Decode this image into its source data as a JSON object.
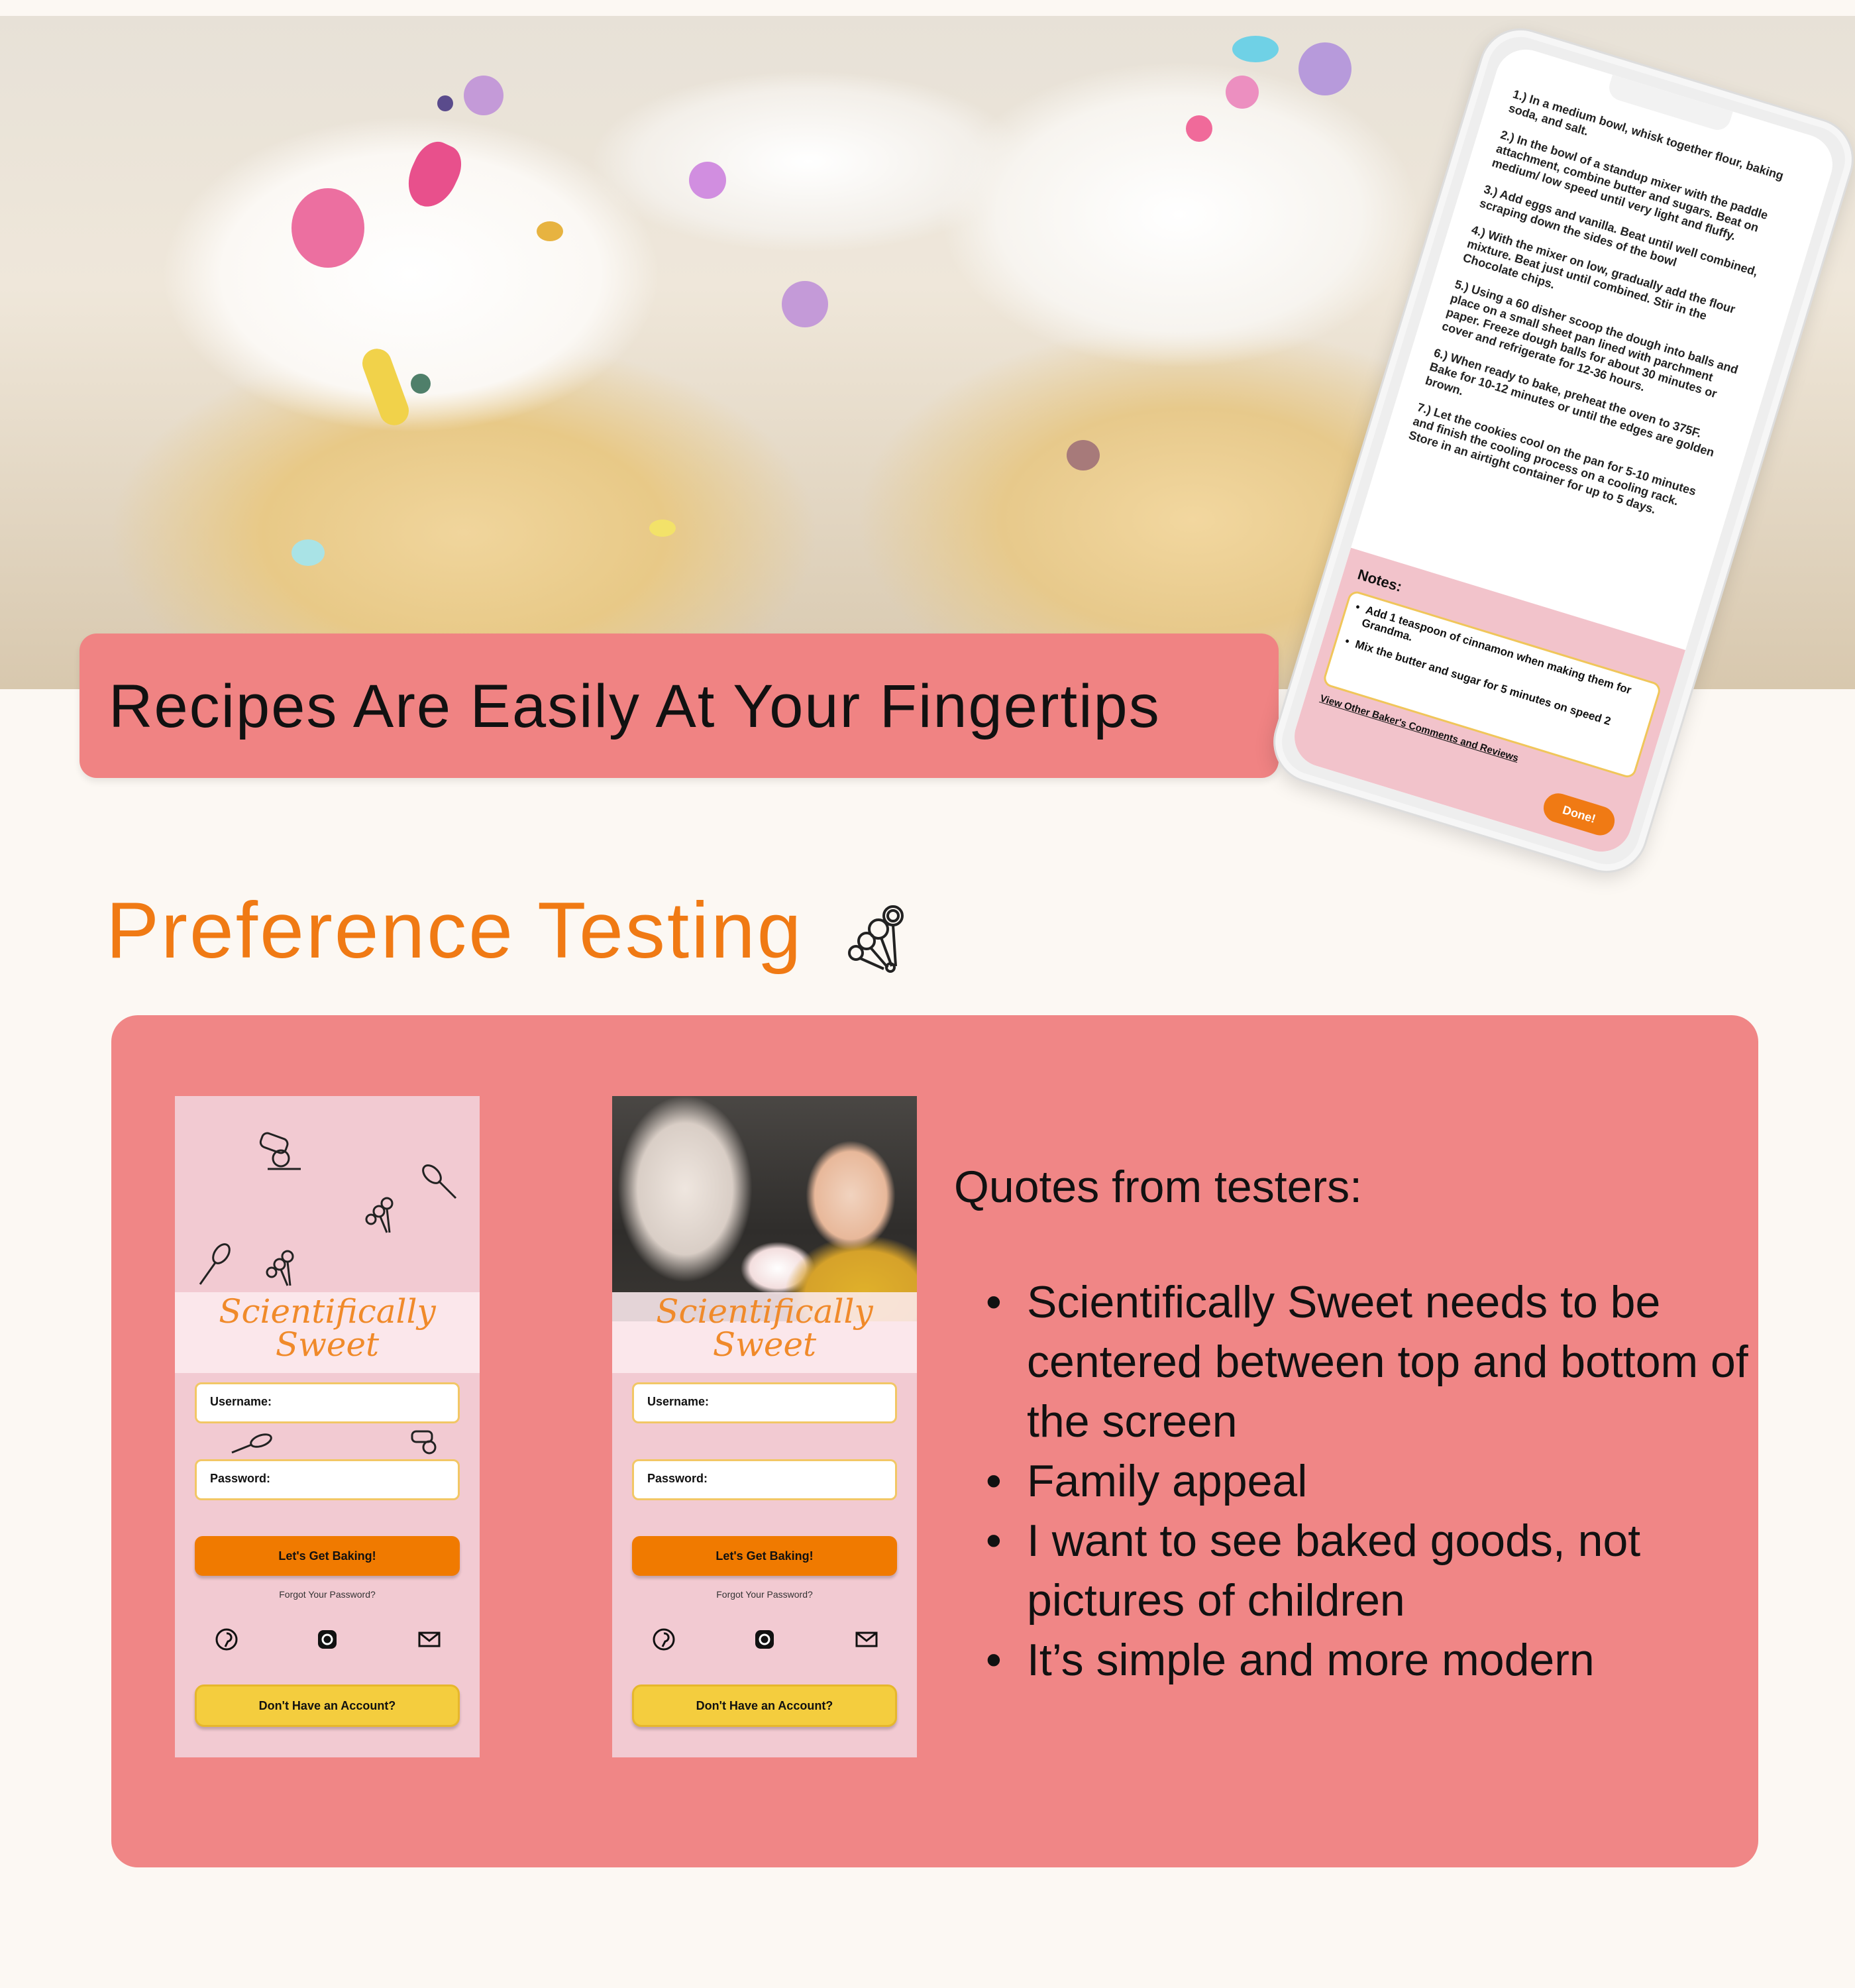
{
  "hero": {
    "banner": "Recipes Are Easily At Your Fingertips"
  },
  "phone": {
    "steps": [
      "1.) In a medium bowl, whisk together flour, baking soda, and salt.",
      "2.) In the bowl of a standup mixer with the paddle attachment, combine butter and sugars. Beat on medium/ low speed until very light and fluffy.",
      "3.) Add eggs and vanilla. Beat until well combined, scraping down the sides of the bowl",
      "4.) With the mixer on low, gradually add the flour mixture. Beat just until combined. Stir in the Chocolate chips.",
      "5.) Using a 60 disher scoop the dough into balls and place on a small sheet pan lined with parchment paper. Freeze dough balls for about 30 minutes or cover and refrigerate for 12-36 hours.",
      "6.) When ready to bake, preheat the oven to 375F. Bake for 10-12 minutes or until the edges are golden brown.",
      "7.) Let the cookies cool on the pan for 5-10 minutes and finish the cooling process on a cooling rack. Store in an airtight container for up to 5 days."
    ],
    "notes_label": "Notes:",
    "notes": [
      "Add 1 teaspoon of cinnamon when making them for Grandma.",
      "Mix the butter and sugar for 5 minutes on speed 2"
    ],
    "notes_link": "View Other Baker's Comments and Reviews",
    "done_label": "Done!"
  },
  "section": {
    "title": "Preference Testing",
    "icon": "measuring-spoons-icon"
  },
  "mockups": [
    {
      "brand_line1": "Scientifically",
      "brand_line2": "Sweet",
      "username_label": "Username:",
      "password_label": "Password:",
      "primary_button": "Let's Get Baking!",
      "forgot_link": "Forgot Your Password?",
      "secondary_button": "Don't Have an Account?",
      "social_icons": [
        "pinterest-icon",
        "instagram-icon",
        "mail-icon"
      ]
    },
    {
      "brand_line1": "Scientifically",
      "brand_line2": "Sweet",
      "username_label": "Username:",
      "password_label": "Password:",
      "primary_button": "Let's Get Baking!",
      "forgot_link": "Forgot Your Password?",
      "secondary_button": "Don't Have an Account?",
      "social_icons": [
        "pinterest-icon",
        "instagram-icon",
        "mail-icon"
      ]
    }
  ],
  "quotes": {
    "title": "Quotes from testers:",
    "items": [
      "Scientifically Sweet needs to be centered between top and bottom of the screen",
      "Family appeal",
      "I want to see baked goods, not pictures of children",
      "It’s simple and more modern"
    ]
  },
  "colors": {
    "background": "#fcf8f3",
    "banner": "#f08383",
    "panel": "#f08686",
    "accent_orange": "#f07a14",
    "mock_pink": "#f2cad2",
    "button_yellow": "#f4cd3e"
  }
}
